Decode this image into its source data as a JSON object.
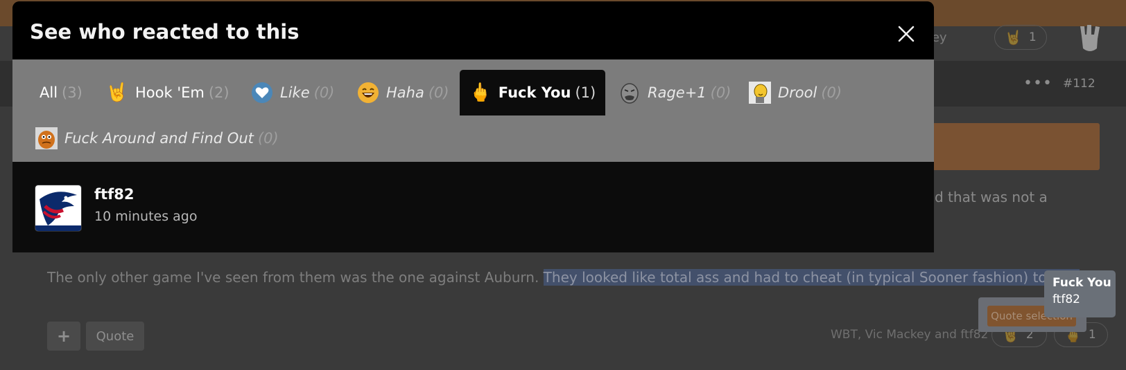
{
  "modal": {
    "title": "See who reacted to this",
    "tabs": [
      {
        "label": "All",
        "count": "(3)",
        "icon": "none"
      },
      {
        "label": "Hook 'Em",
        "count": "(2)",
        "icon": "hook-em-horns-icon"
      },
      {
        "label": "Like",
        "count": "(0)",
        "icon": "heart-icon"
      },
      {
        "label": "Haha",
        "count": "(0)",
        "icon": "laughing-face-icon"
      },
      {
        "label": "Fuck You",
        "count": "(1)",
        "icon": "middle-finger-icon",
        "active": true
      },
      {
        "label": "Rage+1",
        "count": "(0)",
        "icon": "rage-face-icon"
      },
      {
        "label": "Drool",
        "count": "(0)",
        "icon": "drool-icon"
      },
      {
        "label": "Fuck Around and Find Out",
        "count": "(0)",
        "icon": "gritty-mascot-icon"
      }
    ],
    "reactors": [
      {
        "name": "ftf82",
        "time": "10 minutes ago",
        "avatar": "usa-rugby-eagle-avatar"
      }
    ]
  },
  "background": {
    "reacts_summary": "c Mackey",
    "top_react_count": "1",
    "post_number": "#112",
    "truncated_text": "d that was not a",
    "body_line_start": "The only other game I've seen from them was the one against Auburn. ",
    "body_line_highlight": "They looked like total ass and had to cheat (in typical Sooner fashion) to win.",
    "quote_button": "Quote",
    "quote_selection": "Quote selection",
    "reactors_line": "WBT, Vic Mackey and ftf82",
    "react_count_hook": "2",
    "react_count_fy": "1"
  },
  "tooltip": {
    "title": "Fuck You",
    "user": "ftf82"
  },
  "colors": {
    "modal_bg": "#0e0e0e",
    "header_bg": "#000000",
    "tabs_bg": "#7c7c7c",
    "page_bg": "#3b3b3b",
    "accent_orange": "#7a5232",
    "highlight": "#43506b"
  }
}
